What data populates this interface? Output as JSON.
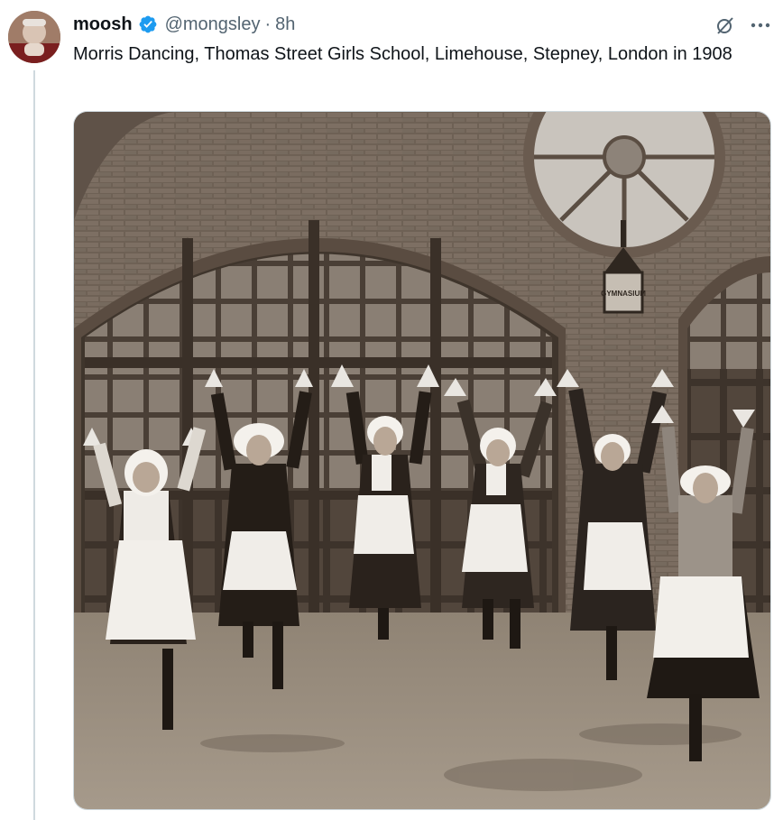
{
  "author": {
    "display_name": "moosh",
    "handle": "@mongsley",
    "timestamp": "8h",
    "separator": "·",
    "verified_color": "#1d9bf0"
  },
  "tweet": {
    "text": "Morris Dancing, Thomas Street Girls School, Limehouse, Stepney, London in 1908"
  },
  "photo": {
    "sign_text": "GYMNASIUM"
  },
  "icons": {
    "verified": "verified-badge-icon",
    "grok": "grok-icon",
    "more": "more-options-icon"
  }
}
